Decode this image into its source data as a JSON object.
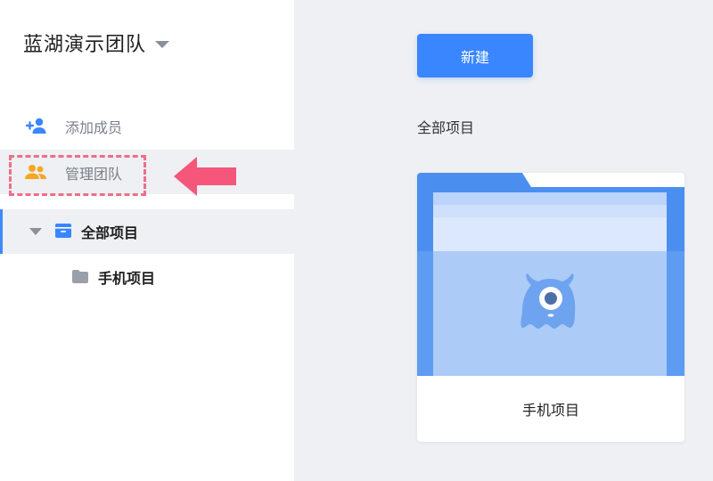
{
  "sidebar": {
    "team_name": "蓝湖演示团队",
    "menu": {
      "add_member": "添加成员",
      "manage_team": "管理团队"
    },
    "tree": {
      "root_label": "全部项目",
      "children": [
        {
          "label": "手机项目"
        }
      ]
    }
  },
  "main": {
    "new_button_label": "新建",
    "section_title": "全部项目",
    "projects": [
      {
        "name": "手机项目"
      }
    ]
  },
  "icons": {
    "team_caret": "chevron-down-icon",
    "add_member": "person-add-icon",
    "manage_team": "people-icon",
    "tree_toggle": "caret-down-icon",
    "tree_root": "folder-box-icon",
    "tree_child": "folder-icon",
    "annotation": "arrow-left-icon",
    "card_mascot": "monster-mascot-icon"
  },
  "colors": {
    "accent": "#3a86ff",
    "annotation": "#ef6d8a",
    "manage_icon": "#f5a623",
    "selected_bg": "#eef0f3"
  }
}
